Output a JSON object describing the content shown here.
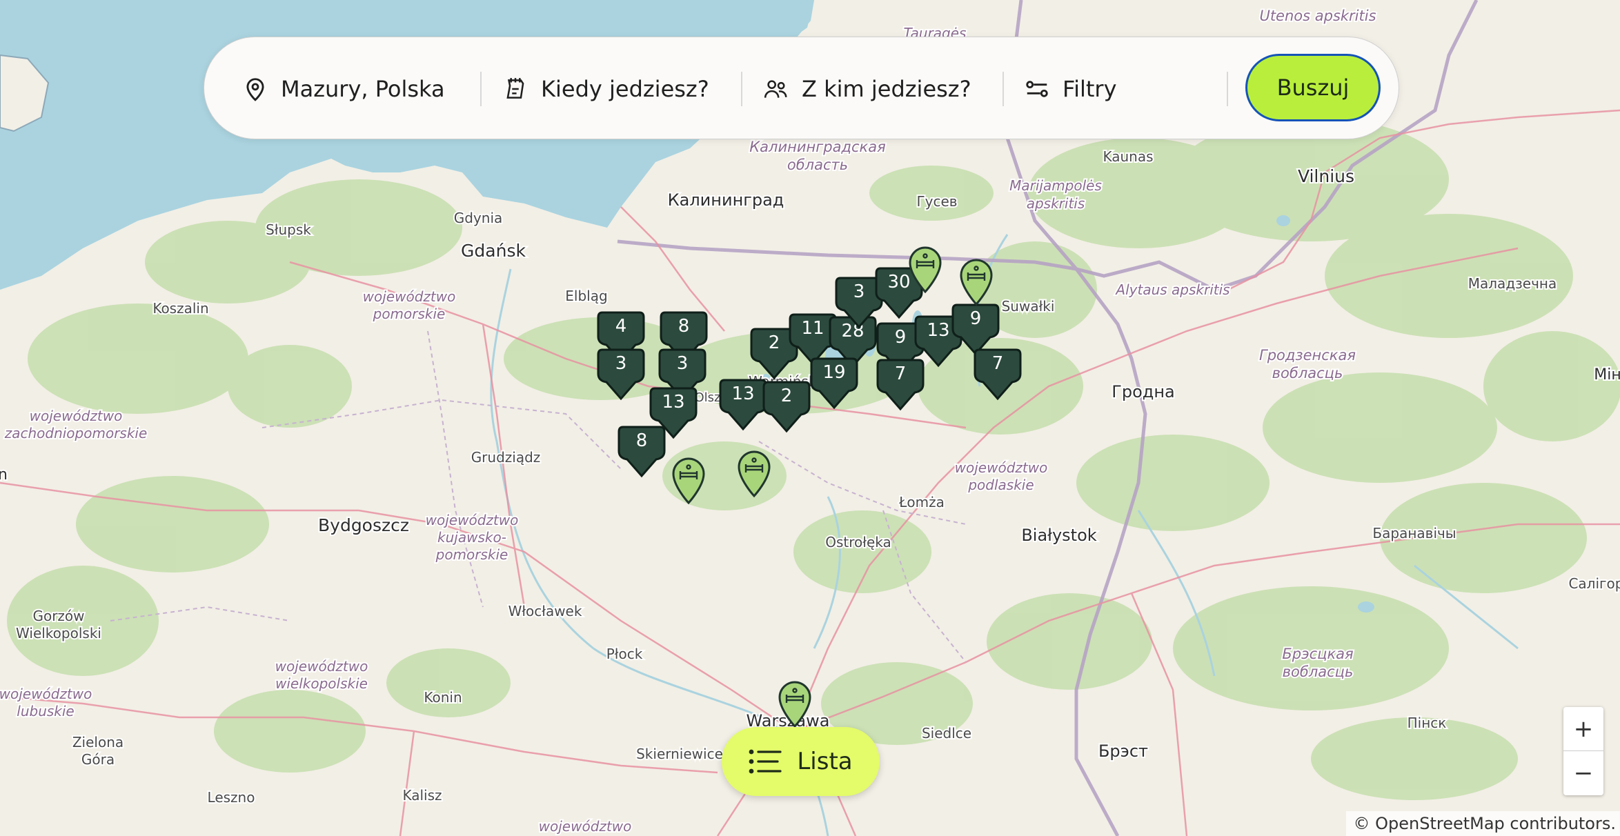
{
  "search": {
    "location": "Mazury, Polska",
    "when": "Kiedy jedziesz?",
    "who": "Z kim jedziesz?",
    "filters": "Filtry",
    "search_button": "Buszuj"
  },
  "list_button": "Lista",
  "zoom": {
    "in": "+",
    "out": "−"
  },
  "attribution": "© OpenStreetMap contributors.",
  "colors": {
    "cluster": "#2c4a3e",
    "pin": "#a9d57a",
    "accent": "#b9ef3c",
    "list_button": "#e4fb6a"
  },
  "clusters": [
    "4",
    "8",
    "3",
    "3",
    "13",
    "8",
    "2",
    "11",
    "28",
    "3",
    "30",
    "9",
    "13",
    "9",
    "19",
    "7",
    "7",
    "13",
    "2"
  ],
  "map_labels": {
    "utenos": "Utenos apskritis",
    "taurages": "Tauragės",
    "kaunas": "Kaunas",
    "vilnius": "Vilnius",
    "kaliningrad_obl": "Калининградская",
    "kaliningrad_obl2": "область",
    "kaliningrad": "Калининград",
    "gusev": "Гусев",
    "marijampoles": "Marijampolės",
    "marijampoles2": "apskritis",
    "slupsk": "Słupsk",
    "gdynia": "Gdynia",
    "gdansk": "Gdańsk",
    "koszalin": "Koszalin",
    "pomorskie1": "województwo",
    "pomorskie2": "pomorskie",
    "elblag": "Elbląg",
    "alytaus": "Alytaus apskritis",
    "suwalki": "Suwałki",
    "maladzechna": "Маладзечна",
    "grodno_obl1": "Гродзенская",
    "grodno_obl2": "вобласць",
    "grodna": "Гродна",
    "minsk": "Мін",
    "olsztyn": "Olsztyn",
    "warminsko": "Warmińsko",
    "zachod1": "województwo",
    "zachod2": "zachodniopomorskie",
    "grudziadz": "Grudziądz",
    "podlaskie1": "województwo",
    "podlaskie2": "podlaskie",
    "lomza": "Łomża",
    "bydgoszcz": "Bydgoszcz",
    "kuj1": "województwo",
    "kuj2": "kujawsko-",
    "kuj3": "pomorskie",
    "ostroleka": "Ostrołęka",
    "bialystok": "Białystok",
    "baranavichy": "Баранавічы",
    "gorzow1": "Gorzów",
    "gorzow2": "Wielkopolski",
    "wloclawek": "Włocławek",
    "saligorsk": "Салігорск",
    "plock": "Płock",
    "wlkp1": "województwo",
    "wlkp2": "wielkopolskie",
    "brest_obl1": "Брэсцкая",
    "brest_obl2": "вобласць",
    "lub1": "województwo",
    "lub2": "lubuskie",
    "konin": "Konin",
    "zielona1": "Zielona",
    "zielona2": "Góra",
    "warszawa": "Warszawa",
    "pinsk": "Пінск",
    "skierniewice": "Skierniewice",
    "siedlce": "Siedlce",
    "brest": "Брэст",
    "kalisz": "Kalisz",
    "leszno": "Leszno",
    "bottom_woj": "województwo",
    "left_n": "n"
  }
}
